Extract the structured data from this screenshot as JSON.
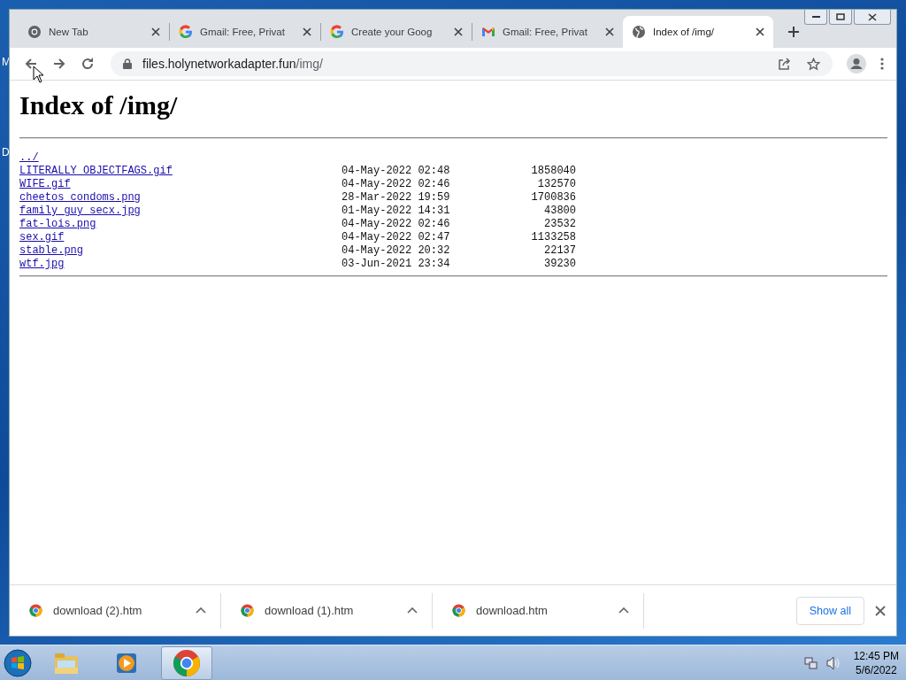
{
  "desktop": {
    "icon_labels": [
      "M",
      "D"
    ]
  },
  "tabs": [
    {
      "title": "New Tab",
      "kind": "chrome",
      "selected": false
    },
    {
      "title": "Gmail: Free, Privat",
      "kind": "google",
      "selected": false
    },
    {
      "title": "Create your Goog",
      "kind": "google",
      "selected": false
    },
    {
      "title": "Gmail: Free, Privat",
      "kind": "gmail",
      "selected": false
    },
    {
      "title": "Index of /img/",
      "kind": "globe",
      "selected": true
    }
  ],
  "address_bar": {
    "host": "files.holynetworkadapter.fun",
    "path": "/img/"
  },
  "page": {
    "heading": "Index of /img/",
    "parent_link": "../",
    "entries": [
      {
        "name": "LITERALLY_OBJECTFAGS.gif",
        "modified": "04-May-2022 02:48",
        "size": "1858040"
      },
      {
        "name": "WIFE.gif",
        "modified": "04-May-2022 02:46",
        "size": "132570"
      },
      {
        "name": "cheetos_condoms.png",
        "modified": "28-Mar-2022 19:59",
        "size": "1700836"
      },
      {
        "name": "family_guy_secx.jpg",
        "modified": "01-May-2022 14:31",
        "size": "43800"
      },
      {
        "name": "fat-lois.png",
        "modified": "04-May-2022 02:46",
        "size": "23532"
      },
      {
        "name": "sex.gif",
        "modified": "04-May-2022 02:47",
        "size": "1133258"
      },
      {
        "name": "stable.png",
        "modified": "04-May-2022 20:32",
        "size": "22137"
      },
      {
        "name": "wtf.jpg",
        "modified": "03-Jun-2021 23:34",
        "size": "39230"
      }
    ]
  },
  "downloads": {
    "items": [
      "download (2).htm",
      "download (1).htm",
      "download.htm"
    ],
    "show_all": "Show all"
  },
  "taskbar": {
    "apps": [
      {
        "kind": "explorer",
        "selected": false
      },
      {
        "kind": "media",
        "selected": false
      },
      {
        "kind": "chrome",
        "selected": true
      }
    ],
    "time": "12:45 PM",
    "date": "5/6/2022"
  }
}
